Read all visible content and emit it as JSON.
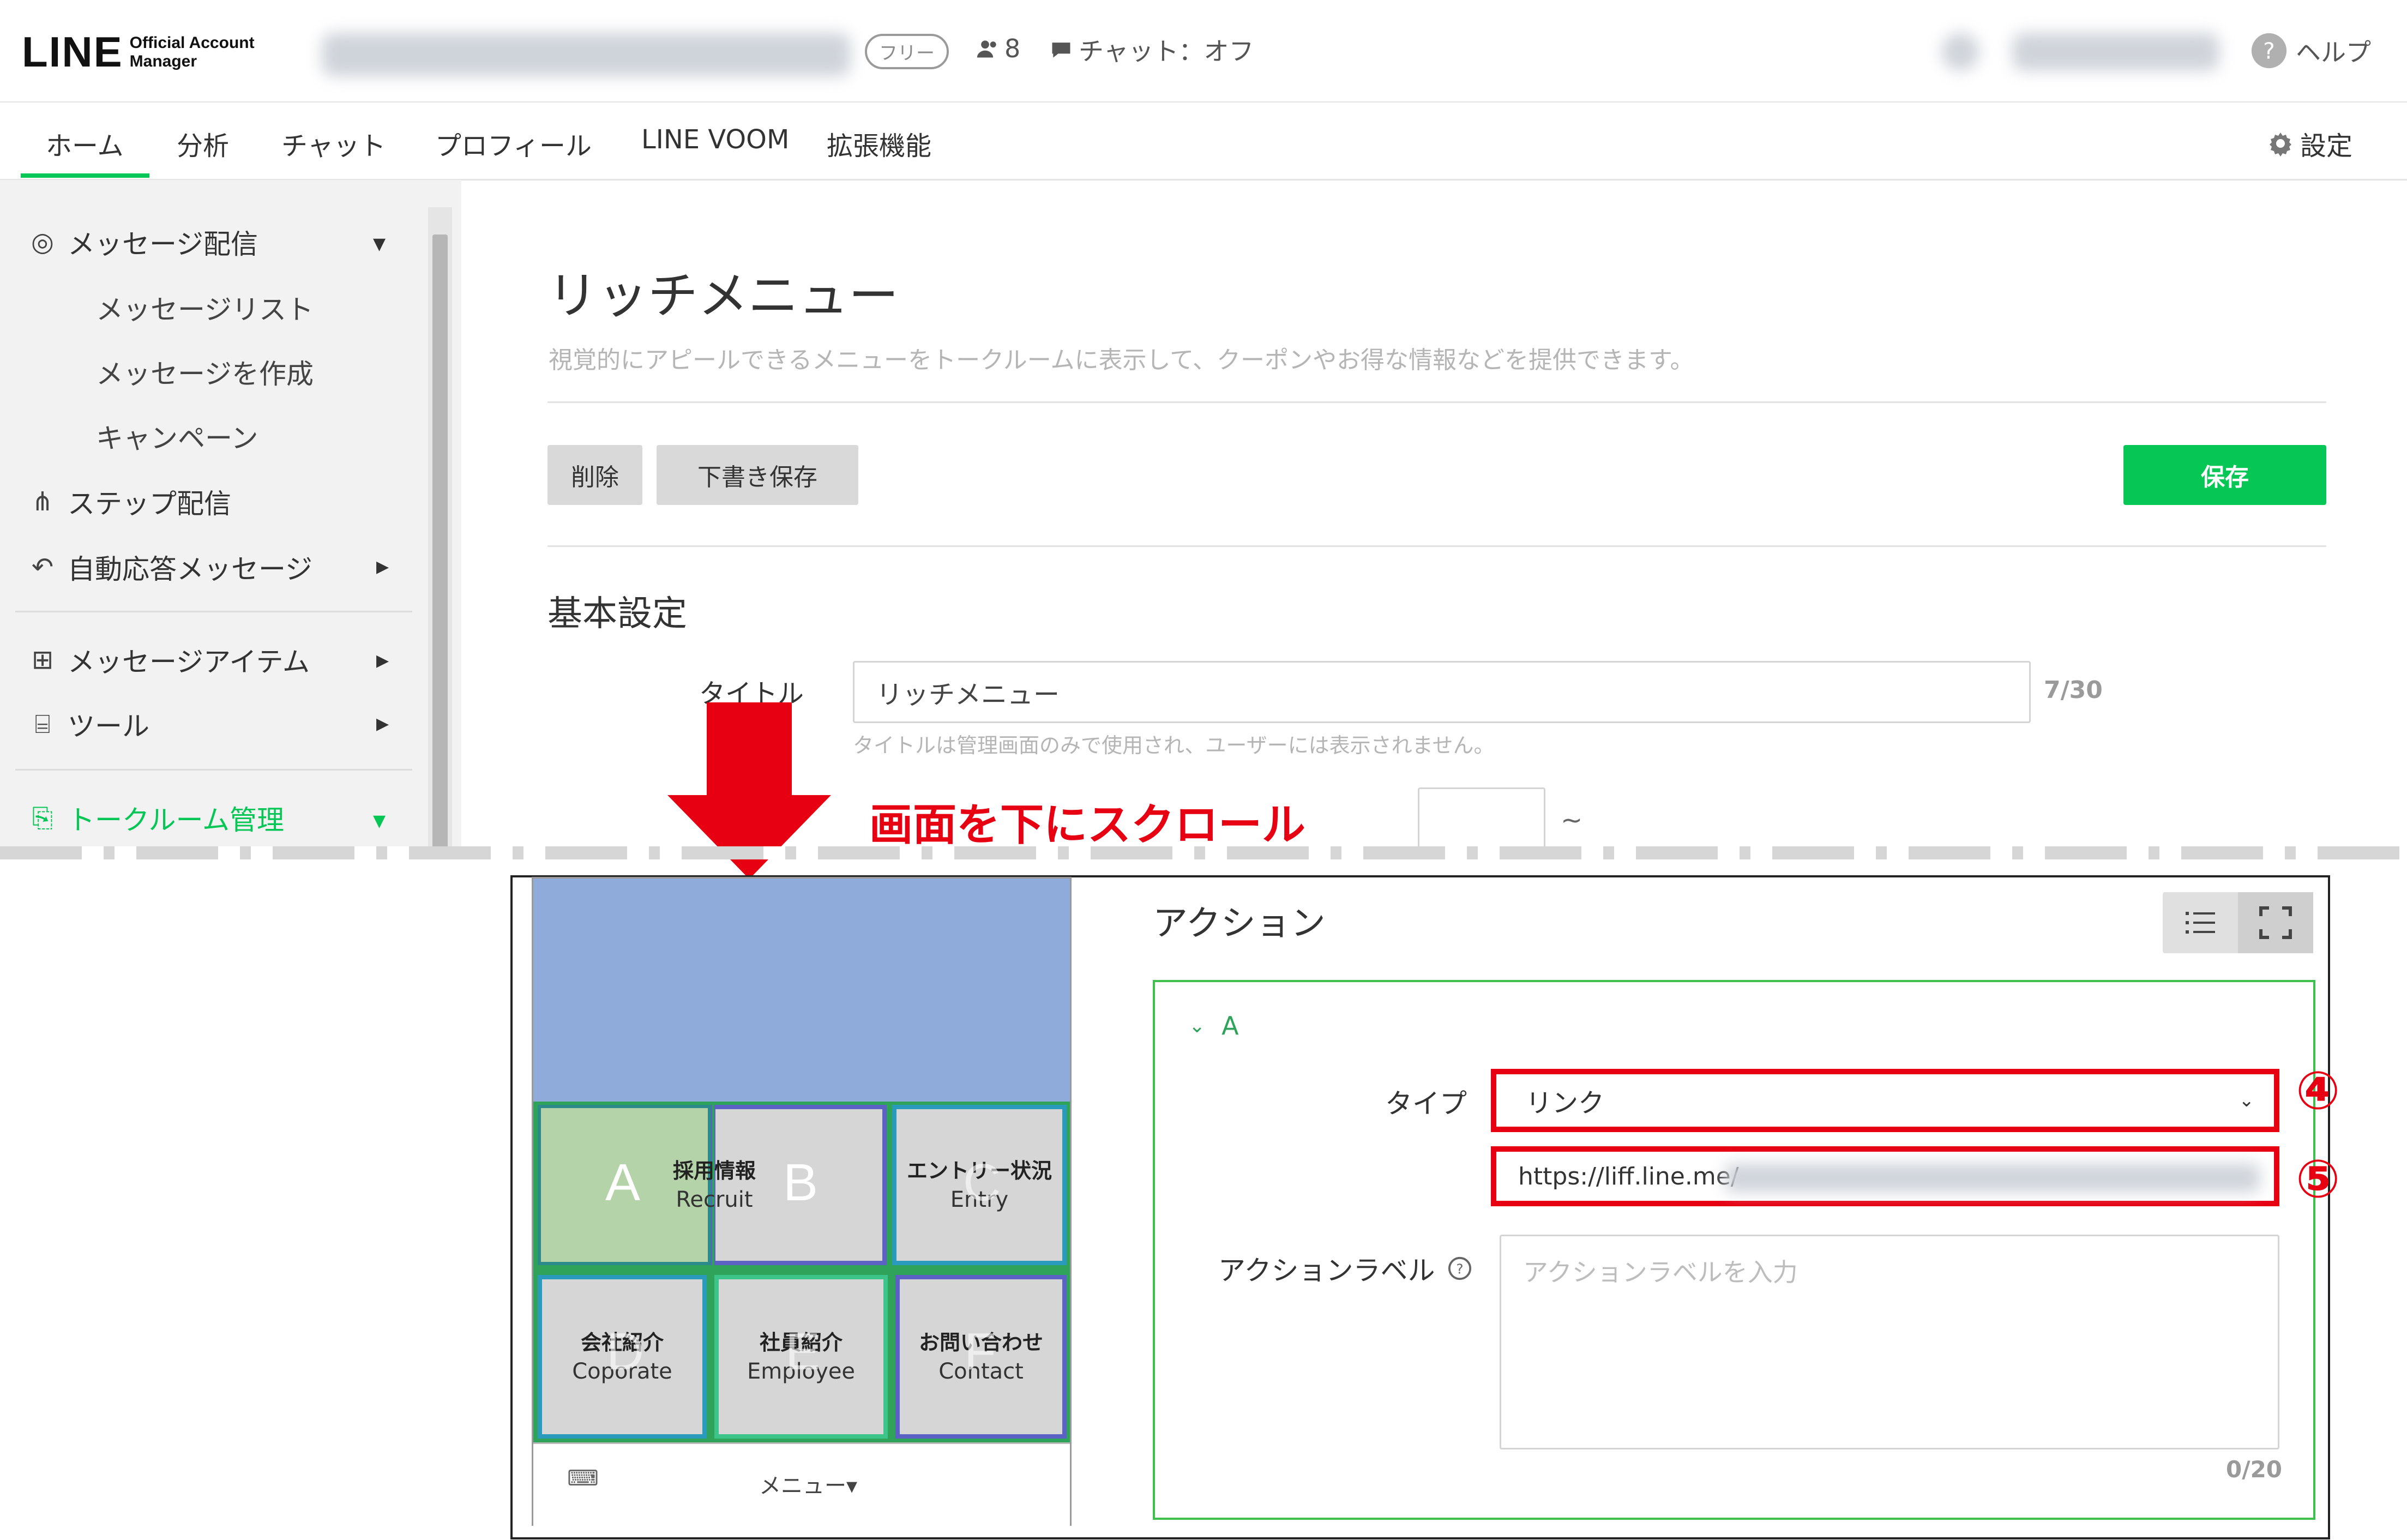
{
  "header": {
    "logo_main": "LINE",
    "logo_sub_1": "Official Account",
    "logo_sub_2": "Manager",
    "plan_badge": "フリー",
    "followers_count": "8",
    "chat_status": "チャット：オフ",
    "help_label": "ヘルプ"
  },
  "nav": {
    "tabs": [
      "ホーム",
      "分析",
      "チャット",
      "プロフィール",
      "LINE VOOM",
      "拡張機能"
    ],
    "settings_label": "設定"
  },
  "sidebar": {
    "message_delivery": "メッセージ配信",
    "message_list": "メッセージリスト",
    "create_message": "メッセージを作成",
    "campaign": "キャンペーン",
    "step_delivery": "ステップ配信",
    "auto_reply": "自動応答メッセージ",
    "message_items": "メッセージアイテム",
    "tools": "ツール",
    "talkroom_mgmt": "トークルーム管理"
  },
  "main": {
    "page_title": "リッチメニュー",
    "page_desc": "視覚的にアピールできるメニューをトークルームに表示して、クーポンやお得な情報などを提供できます。",
    "delete_label": "削除",
    "draft_label": "下書き保存",
    "save_label": "保存",
    "section_basic": "基本設定",
    "title_label": "タイトル",
    "title_value": "リッチメニュー",
    "title_counter": "7/30",
    "title_hint": "タイトルは管理画面のみで使用され、ユーザーには表示されません。",
    "period_sep": "~"
  },
  "annotation": {
    "scroll_text": "画面を下にスクロール",
    "step4": "④",
    "step5": "⑤"
  },
  "preview": {
    "cells": [
      {
        "letter": "A",
        "jp": "採用情報",
        "en": "Recruit"
      },
      {
        "letter": "B",
        "jp": "",
        "en": ""
      },
      {
        "letter": "C",
        "jp": "エントリー状況",
        "en": "Entry"
      },
      {
        "letter": "D",
        "jp": "会社紹介",
        "en": "Coporate"
      },
      {
        "letter": "E",
        "jp": "社員紹介",
        "en": "Employee"
      },
      {
        "letter": "F",
        "jp": "お問い合わせ",
        "en": "Contact"
      }
    ],
    "menu_label": "メニュー▾"
  },
  "action": {
    "heading": "アクション",
    "group_label": "A",
    "type_label": "タイプ",
    "type_value": "リンク",
    "url_value": "https://liff.line.me/",
    "action_label_label": "アクションラベル",
    "action_label_placeholder": "アクションラベルを入力",
    "action_label_counter": "0/20"
  },
  "colors": {
    "line_green": "#06c755",
    "annotation_red": "#e60012",
    "preview_sky": "#8fabd9"
  },
  "icons": [
    "help-icon",
    "settings-gear-icon",
    "broadcast-icon",
    "step-icon",
    "reply-icon",
    "message-item-icon",
    "tool-icon",
    "talkroom-icon",
    "list-view-icon",
    "fullscreen-icon",
    "keyboard-icon"
  ]
}
